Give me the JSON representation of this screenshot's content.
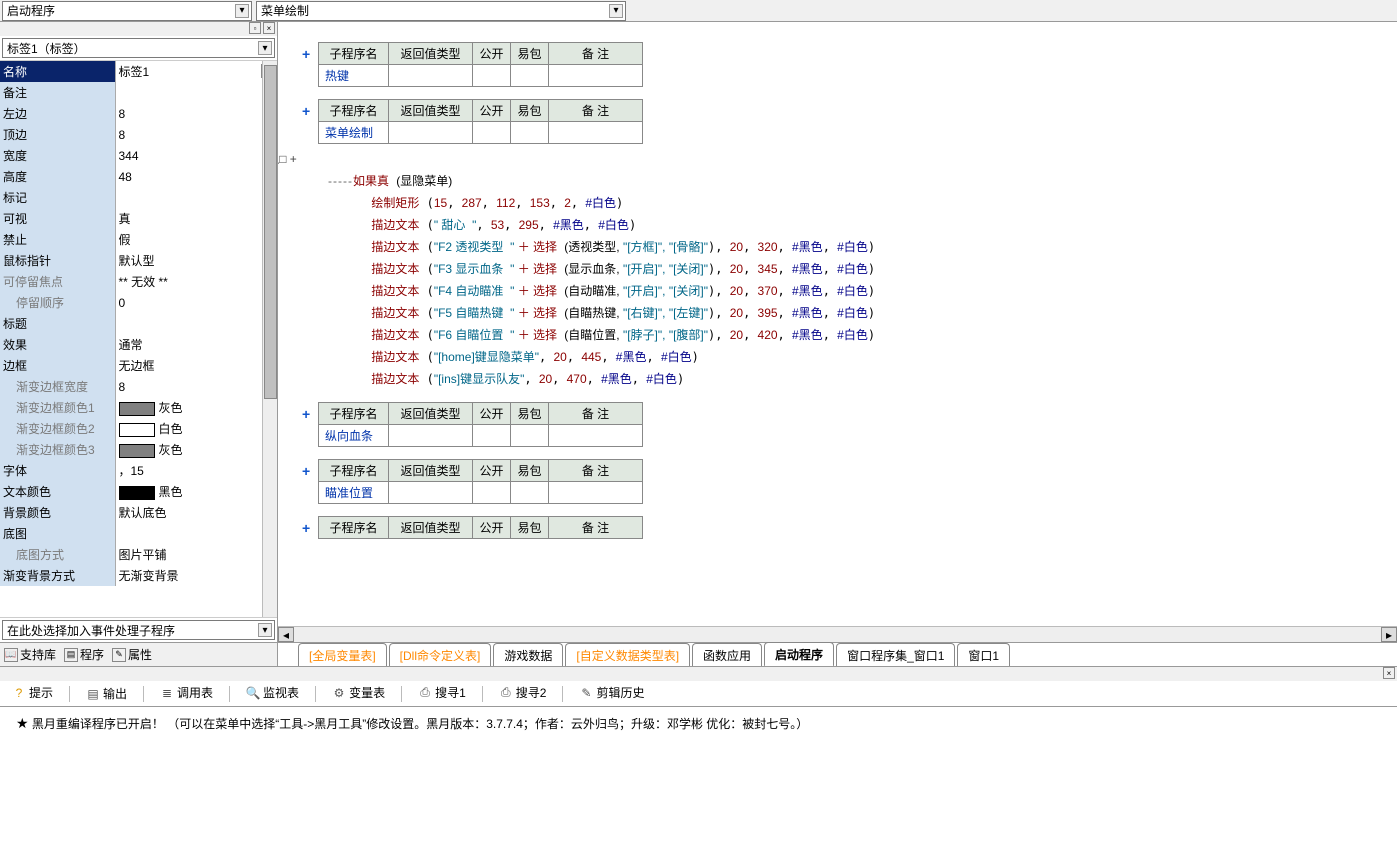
{
  "toolbar": {
    "combo1": "启动程序",
    "combo2": "菜单绘制"
  },
  "propPanel": {
    "objectCombo": "标签1（标签）",
    "eventCombo": "在此处选择加入事件处理子程序",
    "rows": [
      {
        "label": "名称",
        "value": "标签1",
        "sel": true,
        "ell": true
      },
      {
        "label": "备注",
        "value": ""
      },
      {
        "label": "左边",
        "value": "8"
      },
      {
        "label": "顶边",
        "value": "8"
      },
      {
        "label": "宽度",
        "value": "344"
      },
      {
        "label": "高度",
        "value": "48"
      },
      {
        "label": "标记",
        "value": ""
      },
      {
        "label": "可视",
        "value": "真"
      },
      {
        "label": "禁止",
        "value": "假"
      },
      {
        "label": "鼠标指针",
        "value": "默认型"
      },
      {
        "label": "可停留焦点",
        "value": "** 无效 **",
        "disabled": true
      },
      {
        "label": "停留顺序",
        "value": "0",
        "indent": true
      },
      {
        "label": "标题",
        "value": ""
      },
      {
        "label": "效果",
        "value": "通常"
      },
      {
        "label": "边框",
        "value": "无边框"
      },
      {
        "label": "渐变边框宽度",
        "value": "8",
        "indent": true
      },
      {
        "label": "渐变边框颜色1",
        "value": "灰色",
        "swatch": "#808080",
        "indent": true
      },
      {
        "label": "渐变边框颜色2",
        "value": "白色",
        "swatch": "#ffffff",
        "indent": true
      },
      {
        "label": "渐变边框颜色3",
        "value": "灰色",
        "swatch": "#808080",
        "indent": true
      },
      {
        "label": "字体",
        "value": "，15"
      },
      {
        "label": "文本颜色",
        "value": "黑色",
        "swatch": "#000000"
      },
      {
        "label": "背景颜色",
        "value": "默认底色"
      },
      {
        "label": "底图",
        "value": ""
      },
      {
        "label": "底图方式",
        "value": "图片平铺",
        "indent": true
      },
      {
        "label": "渐变背景方式",
        "value": "无渐变背景"
      }
    ],
    "tabs": {
      "support": "支持库",
      "program": "程序",
      "property": "属性"
    }
  },
  "code": {
    "headers": [
      "子程序名",
      "返回值类型",
      "公开",
      "易包",
      "备 注"
    ],
    "subs": [
      {
        "name": "热键",
        "body": []
      },
      {
        "name": "菜单绘制",
        "hasBody": true
      },
      {
        "name": "纵向血条",
        "body": []
      },
      {
        "name": "瞄准位置",
        "body": []
      },
      {
        "name": "",
        "body": [],
        "headerOnly": true
      }
    ],
    "body": {
      "ifLabel": "如果真",
      "ifCond": "(显隐菜单)",
      "l1": {
        "fn": "绘制矩形",
        "args": "(15, 287, 112, 153, 2, #白色)"
      },
      "l2": {
        "fn": "描边文本",
        "argsPre": "(\"  甜心  \", 53, 295, #黑色, #白色)"
      },
      "perLines": [
        {
          "pre": "(\"F2 透视类型  \"",
          "plus": " ＋ ",
          "sel": "选择",
          "args": "(透视类型, ",
          "opt1": "\"[方框]\",",
          "opt2": " \"[骨骼]\"",
          "rest": "), 20, 320, #黑色, #白色)"
        },
        {
          "pre": "(\"F3 显示血条  \"",
          "plus": " ＋ ",
          "sel": "选择",
          "args": "(显示血条, ",
          "opt1": "\"[开启]\",",
          "opt2": " \"[关闭]\"",
          "rest": "), 20, 345, #黑色, #白色)"
        },
        {
          "pre": "(\"F4 自动瞄准  \"",
          "plus": " ＋ ",
          "sel": "选择",
          "args": "(自动瞄准, ",
          "opt1": "\"[开启]\",",
          "opt2": " \"[关闭]\"",
          "rest": "), 20, 370, #黑色, #白色)"
        },
        {
          "pre": "(\"F5 自瞄热键  \"",
          "plus": " ＋ ",
          "sel": "选择",
          "args": "(自瞄热键, ",
          "opt1": "\"[右键]\",",
          "opt2": " \"[左键]\"",
          "rest": "), 20, 395, #黑色, #白色)"
        },
        {
          "pre": "(\"F6 自瞄位置  \"",
          "plus": " ＋ ",
          "sel": "选择",
          "args": "(自瞄位置, ",
          "opt1": "\"[脖子]\",",
          "opt2": " \"[腹部]\"",
          "rest": "), 20, 420, #黑色, #白色)"
        }
      ],
      "l8": {
        "fn": "描边文本",
        "argsRaw": "(\"[home]键显隐菜单\", 20, 445, #黑色, #白色)"
      },
      "l9": {
        "fn": "描边文本",
        "argsRaw": "(\"[ins]键显示队友\", 20, 470, #黑色, #白色)"
      },
      "strobeFn": "描边文本"
    },
    "tabs": [
      {
        "label": "[全局变量表]",
        "special": true
      },
      {
        "label": "[Dll命令定义表]",
        "special": true
      },
      {
        "label": "游戏数据"
      },
      {
        "label": "[自定义数据类型表]",
        "special": true
      },
      {
        "label": "函数应用"
      },
      {
        "label": "启动程序",
        "active": true
      },
      {
        "label": "窗口程序集_窗口1"
      },
      {
        "label": "窗口1"
      }
    ]
  },
  "output": {
    "tabs": [
      {
        "icon": "?",
        "label": "提示",
        "color": "#dd9900"
      },
      {
        "icon": "▤",
        "label": "输出"
      },
      {
        "icon": "≣",
        "label": "调用表"
      },
      {
        "icon": "🔍",
        "label": "监视表"
      },
      {
        "icon": "⚙",
        "label": "变量表"
      },
      {
        "icon": "⎙",
        "label": "搜寻1"
      },
      {
        "icon": "⎙",
        "label": "搜寻2"
      },
      {
        "icon": "✎",
        "label": "剪辑历史"
      }
    ],
    "message": "黑月重编译程序已开启！  （可以在菜单中选择“工具->黑月工具”修改设置。黑月版本：3.7.7.4；作者：云外归鸟；升级：邓学彬 优化：被封七号。）"
  }
}
